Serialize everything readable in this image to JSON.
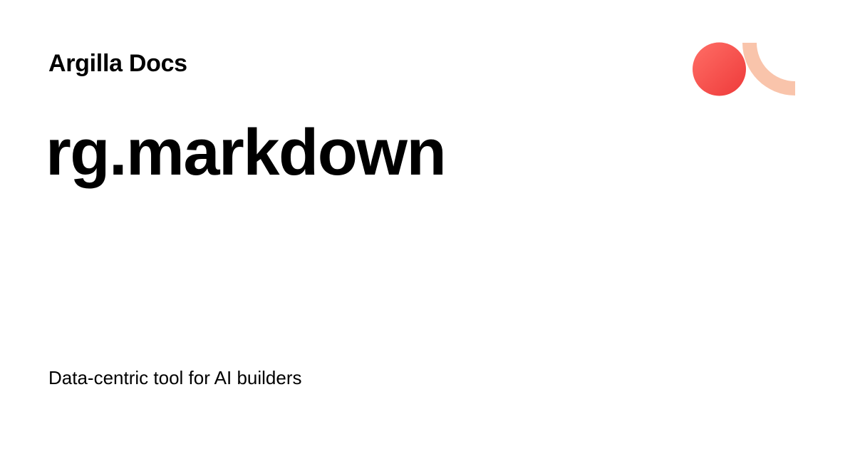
{
  "site": {
    "name": "Argilla Docs",
    "description": "Data-centric tool for AI builders"
  },
  "page": {
    "title": "rg.markdown"
  },
  "logo": {
    "icon": "argilla-logo-icon",
    "colors": {
      "circle_light": "#FF6E66",
      "circle_dark": "#EE3A3A",
      "arc": "#F9C4AB"
    }
  }
}
